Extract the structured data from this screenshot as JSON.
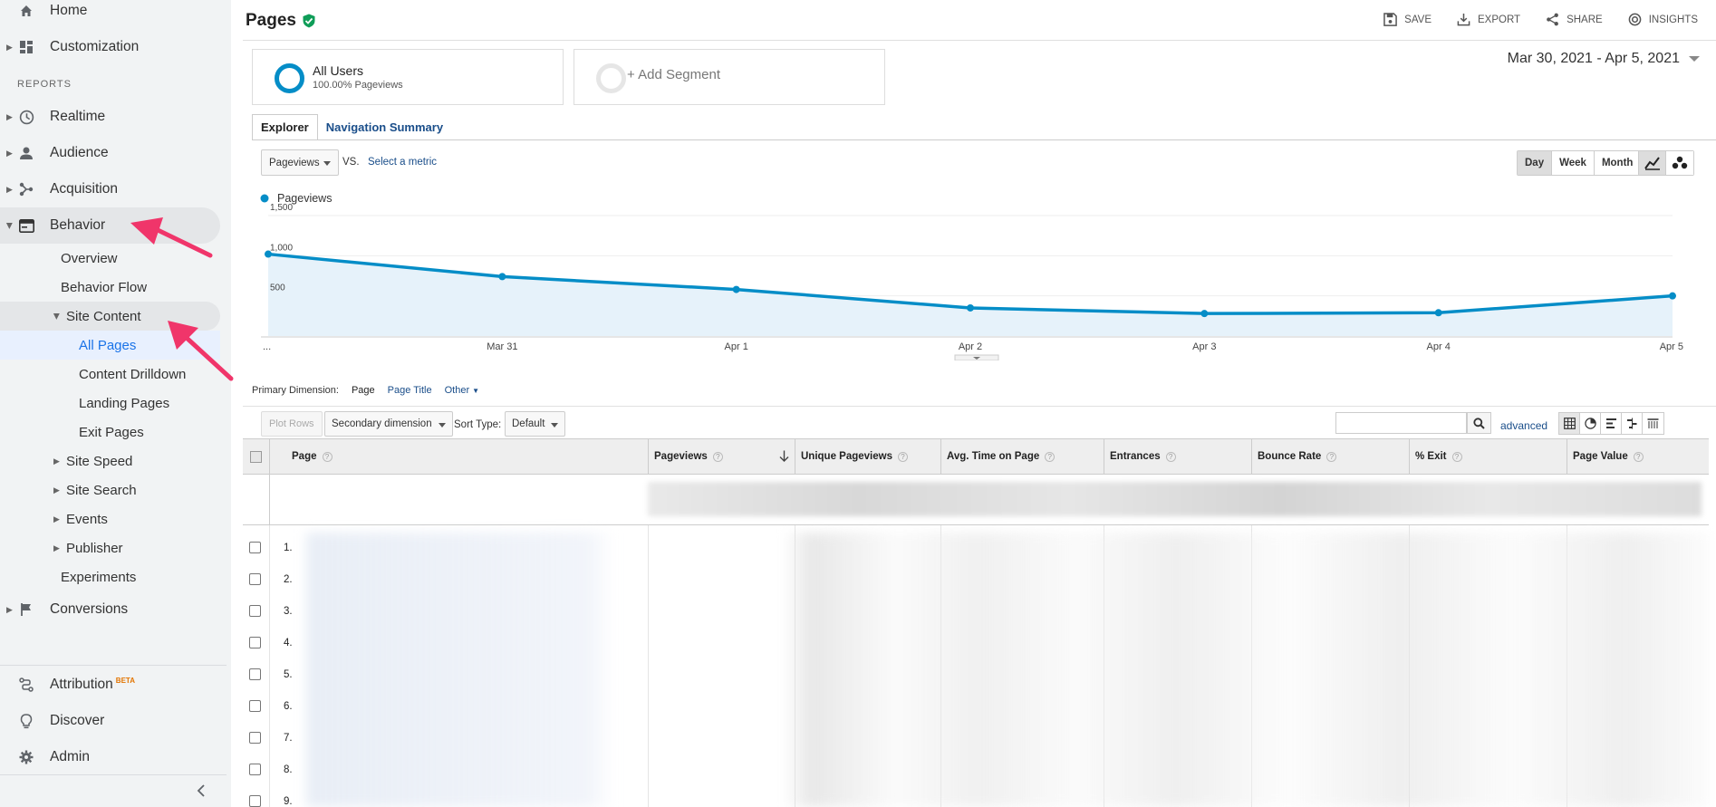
{
  "sidebar": {
    "nav": [
      {
        "label": "Home",
        "icon": "home-icon"
      },
      {
        "label": "Customization",
        "icon": "dashboard-icon"
      }
    ],
    "reports_header": "REPORTS",
    "reports": [
      {
        "label": "Realtime",
        "icon": "clock-icon"
      },
      {
        "label": "Audience",
        "icon": "person-icon"
      },
      {
        "label": "Acquisition",
        "icon": "acquisition-icon"
      },
      {
        "label": "Behavior",
        "icon": "behavior-icon"
      }
    ],
    "behavior_items": {
      "overview": "Overview",
      "behavior_flow": "Behavior Flow",
      "site_content": "Site Content",
      "all_pages": "All Pages",
      "content_drilldown": "Content Drilldown",
      "landing_pages": "Landing Pages",
      "exit_pages": "Exit Pages",
      "site_speed": "Site Speed",
      "site_search": "Site Search",
      "events": "Events",
      "publisher": "Publisher",
      "experiments": "Experiments"
    },
    "conversions": "Conversions",
    "bottom": {
      "attribution": "Attribution",
      "beta": "BETA",
      "discover": "Discover",
      "admin": "Admin"
    }
  },
  "header": {
    "title": "Pages",
    "actions": {
      "save": "SAVE",
      "export": "EXPORT",
      "share": "SHARE",
      "insights": "INSIGHTS"
    }
  },
  "segments": {
    "primary_name": "All Users",
    "primary_sub": "100.00% Pageviews",
    "add": "+ Add Segment"
  },
  "date_range": "Mar 30, 2021 - Apr 5, 2021",
  "tabs": {
    "explorer": "Explorer",
    "navigation_summary": "Navigation Summary"
  },
  "metric": {
    "selected": "Pageviews",
    "vs": "VS.",
    "select_metric": "Select a metric"
  },
  "period": {
    "day": "Day",
    "week": "Week",
    "month": "Month"
  },
  "chart_data": {
    "type": "area",
    "series": [
      {
        "name": "Pageviews",
        "values": [
          1020,
          740,
          580,
          350,
          280,
          290,
          500
        ]
      }
    ],
    "categories": [
      "...",
      "Mar 31",
      "Apr 1",
      "Apr 2",
      "Apr 3",
      "Apr 4",
      "Apr 5"
    ],
    "y_ticks": [
      "1,500",
      "1,000",
      "500"
    ],
    "ylim": [
      0,
      1500
    ],
    "color": "#058dc7",
    "fill": "#e6f2fa",
    "grid": true,
    "legend": "top-left"
  },
  "dimension": {
    "label": "Primary Dimension:",
    "current": "Page",
    "page_title": "Page Title",
    "other": "Other"
  },
  "table_tools": {
    "plot_rows": "Plot Rows",
    "secondary_dimension": "Secondary dimension",
    "sort_type_label": "Sort Type:",
    "sort_type": "Default",
    "advanced": "advanced"
  },
  "table": {
    "columns": [
      "Page",
      "Pageviews",
      "Unique Pageviews",
      "Avg. Time on Page",
      "Entrances",
      "Bounce Rate",
      "% Exit",
      "Page Value"
    ],
    "row_numbers": [
      "1.",
      "2.",
      "3.",
      "4.",
      "5.",
      "6.",
      "7.",
      "8.",
      "9."
    ]
  }
}
